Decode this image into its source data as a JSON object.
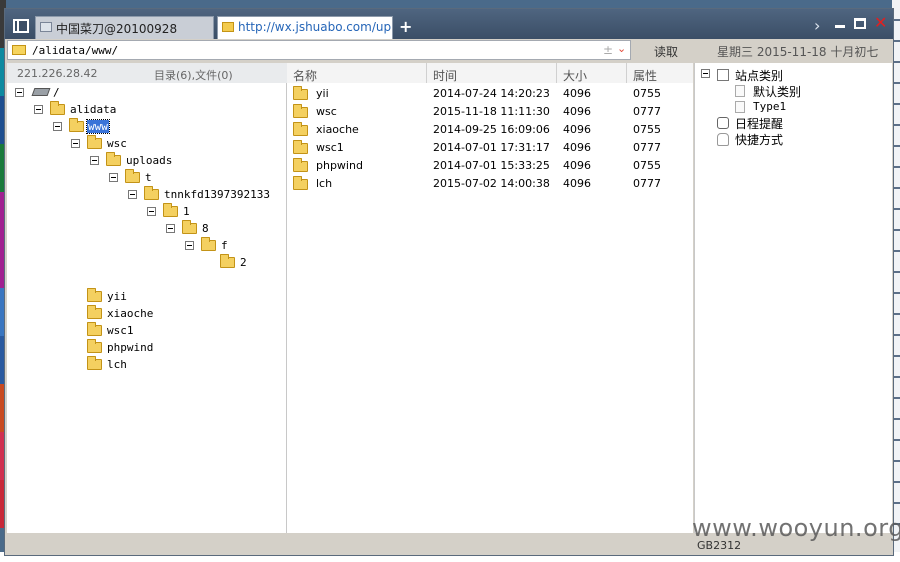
{
  "window": {
    "tabs": [
      {
        "label": "中国菜刀@20100928"
      },
      {
        "label": "http://wx.jshuabo.com/uploa..."
      }
    ],
    "new_tab": "+",
    "chevron": "›",
    "close": "✕"
  },
  "toolbar": {
    "address": "/alidata/www/",
    "plusminus": "±",
    "dropdown": "⌄",
    "read_button": "读取",
    "date": "星期三 2015-11-18 十月初七"
  },
  "left_header": {
    "ip": "221.226.28.42",
    "count": "目录(6),文件(0)"
  },
  "tree": [
    {
      "label": "/",
      "type": "drive",
      "toggle": true
    },
    {
      "label": "alidata",
      "type": "folder",
      "toggle": true
    },
    {
      "label": "www",
      "type": "folder",
      "toggle": true,
      "selected": true
    },
    {
      "label": "wsc",
      "type": "folder",
      "toggle": true
    },
    {
      "label": "uploads",
      "type": "folder",
      "toggle": true
    },
    {
      "label": "t",
      "type": "folder",
      "toggle": true
    },
    {
      "label": "tnnkfd1397392133",
      "type": "folder",
      "toggle": true
    },
    {
      "label": "1",
      "type": "folder",
      "toggle": true
    },
    {
      "label": "8",
      "type": "folder",
      "toggle": true
    },
    {
      "label": "f",
      "type": "folder",
      "toggle": true
    },
    {
      "label": "2",
      "type": "folder",
      "toggle": false
    },
    {
      "label": "yii",
      "type": "folder",
      "toggle": false
    },
    {
      "label": "xiaoche",
      "type": "folder",
      "toggle": false
    },
    {
      "label": "wsc1",
      "type": "folder",
      "toggle": false
    },
    {
      "label": "phpwind",
      "type": "folder",
      "toggle": false
    },
    {
      "label": "lch",
      "type": "folder",
      "toggle": false
    }
  ],
  "file_list": {
    "columns": [
      "名称",
      "时间",
      "大小",
      "属性"
    ],
    "rows": [
      {
        "name": "yii",
        "time": "2014-07-24 14:20:23",
        "size": "4096",
        "attr": "0755"
      },
      {
        "name": "wsc",
        "time": "2015-11-18 11:11:30",
        "size": "4096",
        "attr": "0777"
      },
      {
        "name": "xiaoche",
        "time": "2014-09-25 16:09:06",
        "size": "4096",
        "attr": "0755"
      },
      {
        "name": "wsc1",
        "time": "2014-07-01 17:31:17",
        "size": "4096",
        "attr": "0777"
      },
      {
        "name": "phpwind",
        "time": "2014-07-01 15:33:25",
        "size": "4096",
        "attr": "0755"
      },
      {
        "name": "lch",
        "time": "2015-07-02 14:00:38",
        "size": "4096",
        "attr": "0777"
      }
    ]
  },
  "right_panel": {
    "site_category": "站点类别",
    "default_category": "默认类别",
    "type1": "Type1",
    "schedule": "日程提醒",
    "shortcuts": "快捷方式"
  },
  "status": {
    "encoding": "GB2312"
  },
  "watermark": "www.wooyun.org"
}
